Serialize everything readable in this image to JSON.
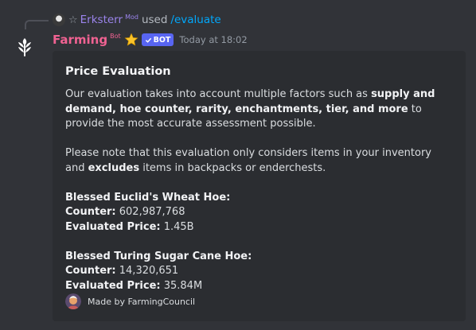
{
  "reply": {
    "username": "Erksterr",
    "role_tag": "Mod",
    "verb": "used",
    "command": "/evaluate"
  },
  "message": {
    "author": "Farming",
    "author_tag": "Bot",
    "badge": "BOT",
    "timestamp": "Today at 18:02"
  },
  "embed": {
    "title": "Price Evaluation",
    "intro": {
      "t1": "Our evaluation takes into account multiple factors such as ",
      "b1": "supply and demand, hoe counter, rarity, enchantments, tier, and more",
      "t2": " to provide the most accurate assessment possible."
    },
    "note": {
      "t1": "Please note that this evaluation only considers items in your inventory and ",
      "b1": "excludes",
      "t2": " items in backpacks or enderchests."
    },
    "items": [
      {
        "name": "Blessed Euclid's Wheat Hoe:",
        "counter_label": "Counter:",
        "counter": "602,987,768",
        "price_label": "Evaluated Price:",
        "price": "1.45B"
      },
      {
        "name": "Blessed Turing Sugar Cane Hoe:",
        "counter_label": "Counter:",
        "counter": "14,320,651",
        "price_label": "Evaluated Price:",
        "price": "35.84M"
      }
    ],
    "footer": "Made by FarmingCouncil"
  },
  "colors": {
    "background": "#313338",
    "embed": "#2b2d31",
    "author": "#f06292",
    "badge": "#5865f2",
    "command": "#00a8fc"
  }
}
